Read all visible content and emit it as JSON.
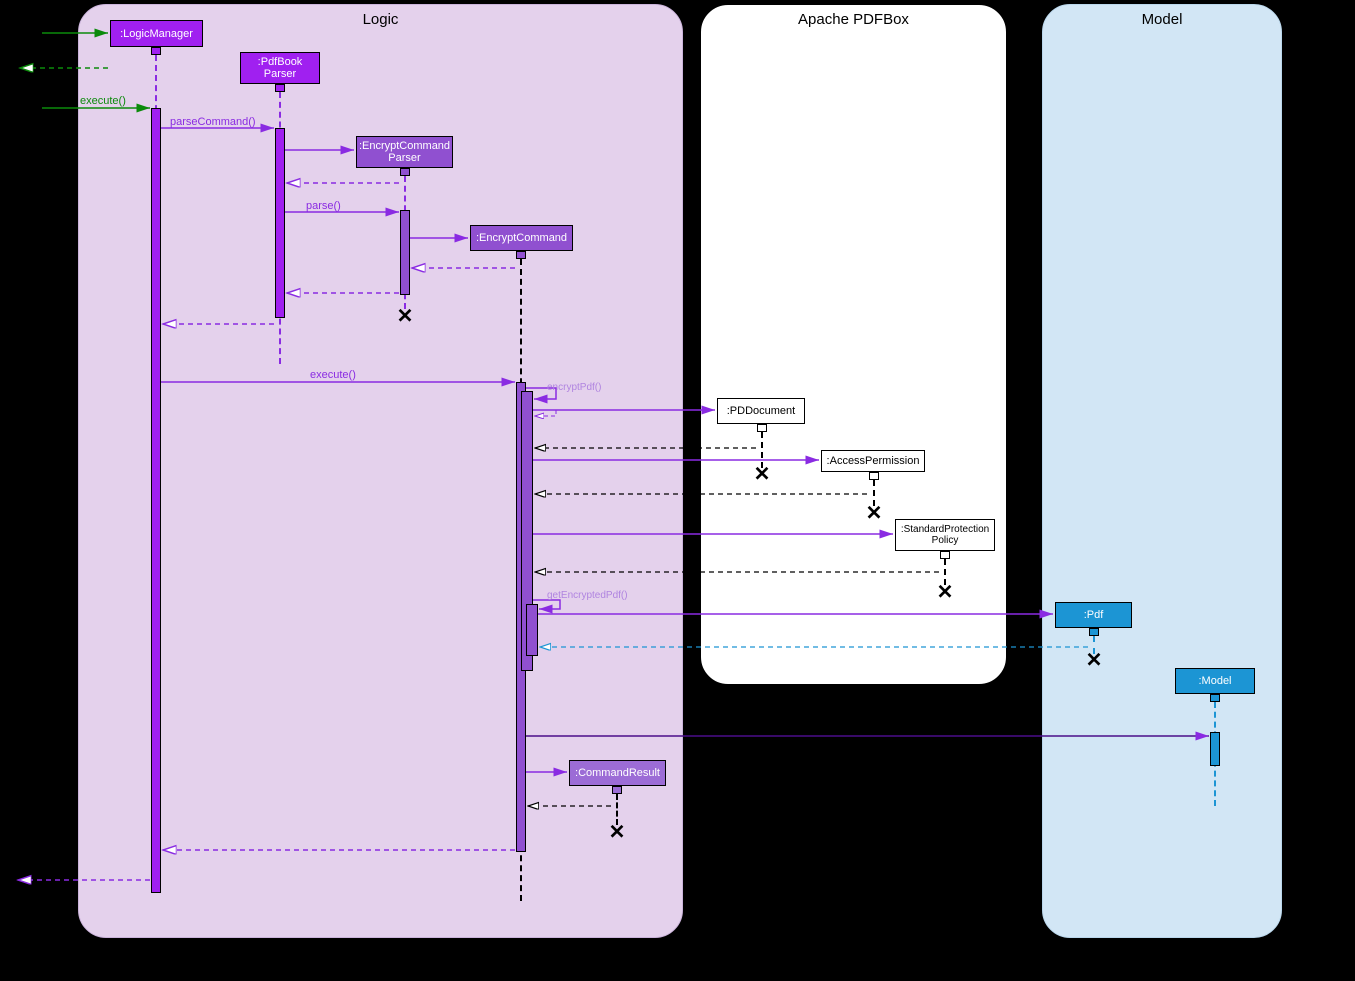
{
  "frames": {
    "logic": {
      "title": "Logic",
      "bg": "#e4d1ec",
      "border": "#d9c4e6"
    },
    "pdfbox": {
      "title": "Apache PDFBox",
      "bg": "#ffffff",
      "border": "#000000"
    },
    "model": {
      "title": "Model",
      "bg": "#d2e6f5",
      "border": "#c4ddf0"
    }
  },
  "participants": {
    "logicManager": ":LogicManager",
    "pdfBookParser": ":PdfBook\nParser",
    "encryptCommandParser": ":EncryptCommand\nParser",
    "encryptCommand": ":EncryptCommand",
    "commandResult": ":CommandResult",
    "pdDocument": ":PDDocument",
    "accessPermission": ":AccessPermission",
    "stdProtectionPolicy": ":StandardProtection\nPolicy",
    "pdf": ":Pdf",
    "modelP": ":Model"
  },
  "messages": {
    "execute": "execute()",
    "parseCommand": "parseCommand()",
    "parse": "parse()",
    "execute2": "execute()",
    "encryptPdf": "encryptPdf()",
    "getEncryptedPdf": "getEncryptedPdf()"
  },
  "colors": {
    "purpleBox": "#a020f0",
    "logicActivation": "#a020f0",
    "purpleMid": "#9050d0",
    "lightPurple": "#9c6cd6",
    "arrowPurple": "#8a2be2",
    "green": "#0b8a0b",
    "blueBox": "#1c95d4",
    "black": "#000000"
  }
}
